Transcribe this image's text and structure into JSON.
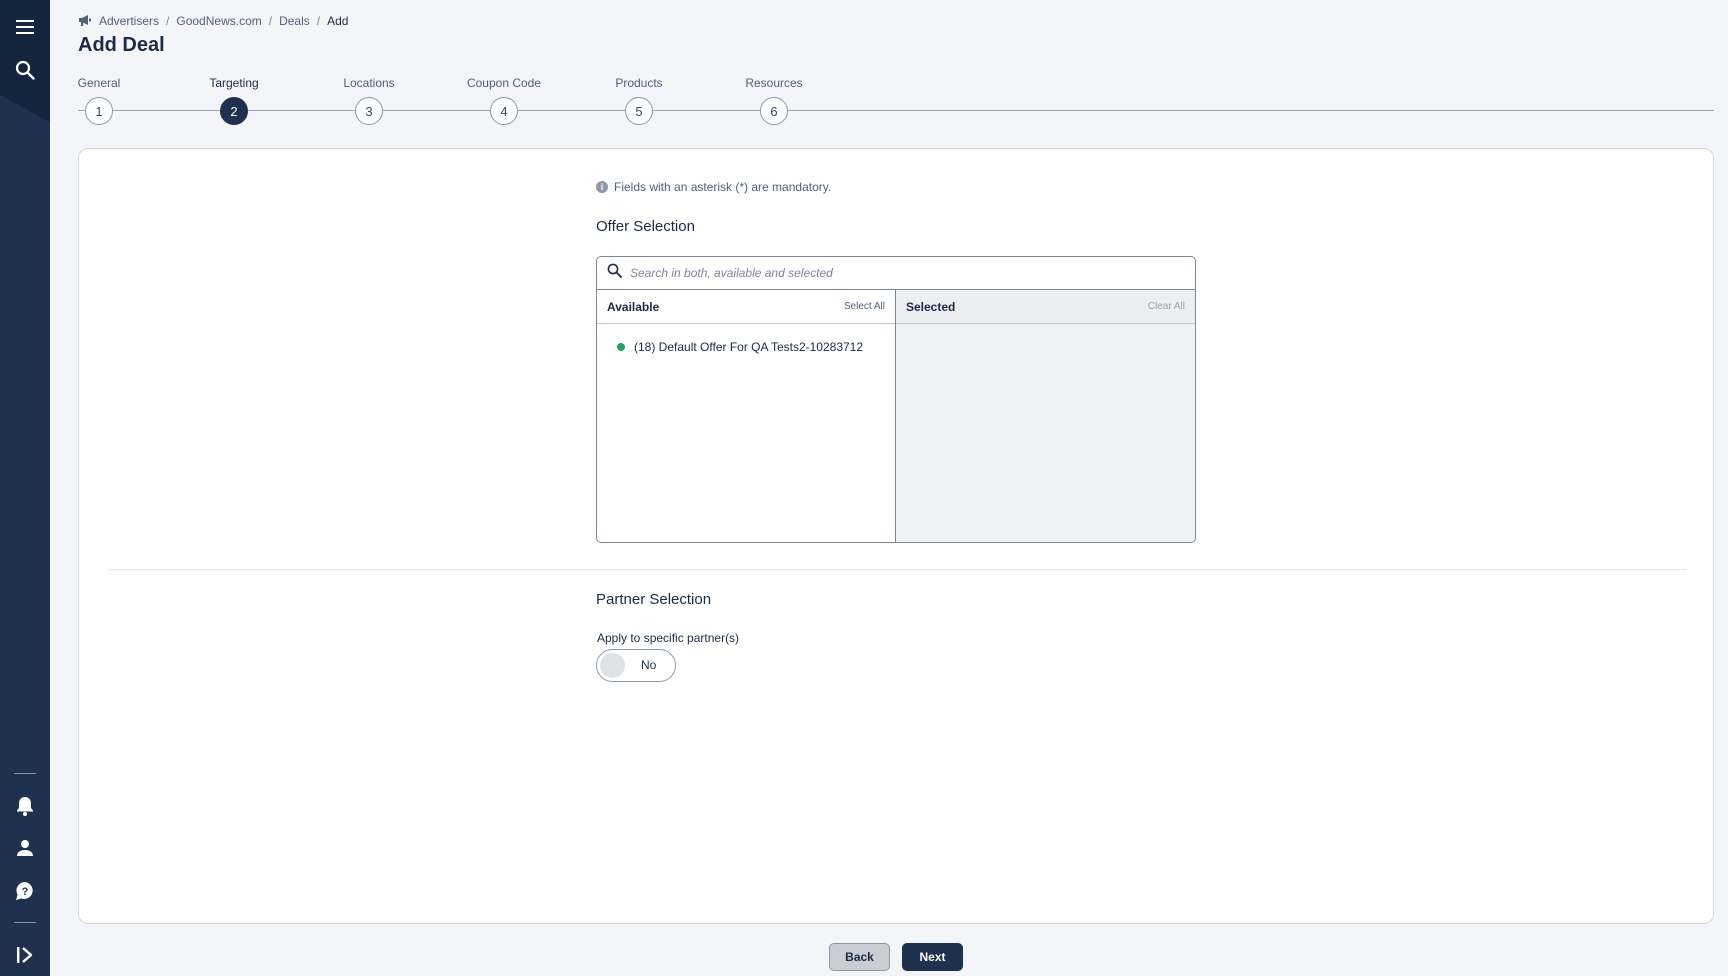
{
  "sidebar": {
    "top_icons": [
      "menu-icon",
      "search-icon"
    ],
    "bottom_icons": [
      "bell-icon",
      "user-icon",
      "help-icon",
      "expand-icon"
    ]
  },
  "breadcrumb": {
    "icon": "megaphone-icon",
    "items": [
      "Advertisers",
      "GoodNews.com",
      "Deals",
      "Add"
    ],
    "separator": "/"
  },
  "page_title": "Add Deal",
  "stepper": {
    "active_index": 1,
    "steps": [
      {
        "label": "General",
        "number": "1"
      },
      {
        "label": "Targeting",
        "number": "2"
      },
      {
        "label": "Locations",
        "number": "3"
      },
      {
        "label": "Coupon Code",
        "number": "4"
      },
      {
        "label": "Products",
        "number": "5"
      },
      {
        "label": "Resources",
        "number": "6"
      }
    ]
  },
  "info_note": "Fields with an asterisk (*) are mandatory.",
  "offer_selection": {
    "title": "Offer Selection",
    "search_placeholder": "Search in both, available and selected",
    "available": {
      "header": "Available",
      "action": "Select All",
      "items": [
        {
          "label": "(18) Default Offer For QA Tests2-10283712",
          "status_color": "#21a366"
        }
      ]
    },
    "selected": {
      "header": "Selected",
      "action": "Clear All",
      "items": []
    }
  },
  "partner_selection": {
    "title": "Partner Selection",
    "field_label": "Apply to specific partner(s)",
    "toggle_value": "No"
  },
  "footer": {
    "back_label": "Back",
    "next_label": "Next"
  },
  "colors": {
    "sidebar": "#1e3250",
    "accent": "#1e3250",
    "status_green": "#21a366"
  }
}
